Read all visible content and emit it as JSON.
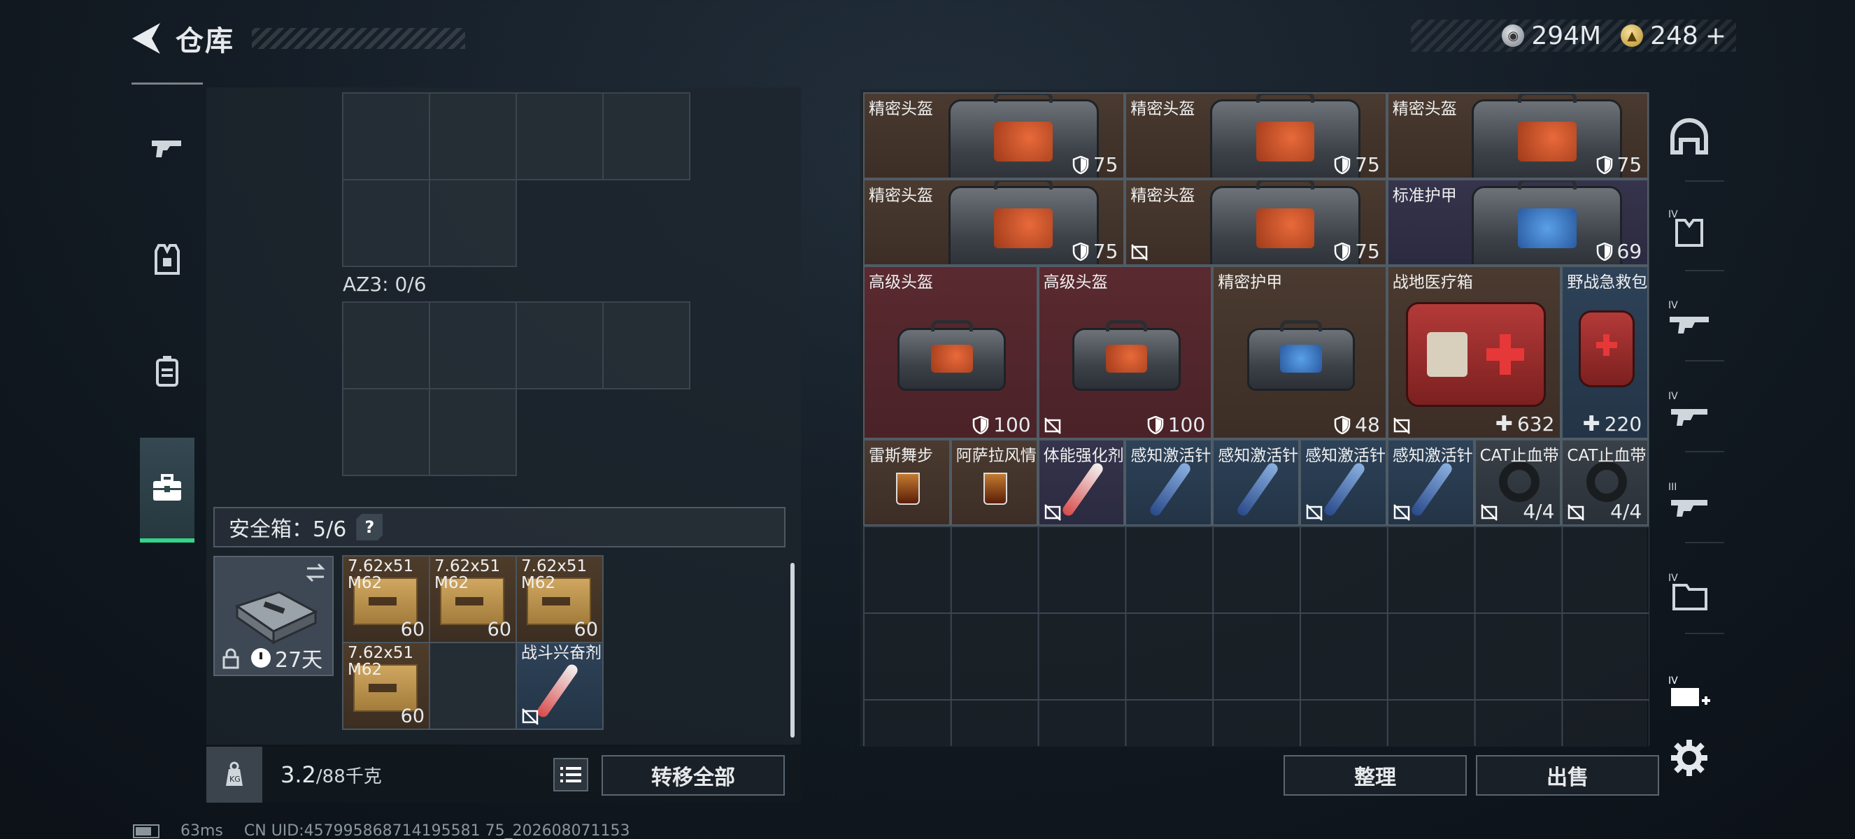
{
  "header": {
    "title": "仓库"
  },
  "currency": {
    "silver": "294M",
    "gold": "248",
    "plus": "+"
  },
  "left_nav": [
    {
      "icon": "gun-icon"
    },
    {
      "icon": "armor-vest-icon"
    },
    {
      "icon": "backpack-icon"
    },
    {
      "icon": "toolbox-icon",
      "active": true
    }
  ],
  "storage": {
    "az_label": "AZ3: 0/6"
  },
  "safe_box": {
    "title": "安全箱：5/6",
    "help": "?",
    "timer": "27天",
    "items": [
      {
        "name": "7.62x51\nM62",
        "count": "60",
        "type": "ammo"
      },
      {
        "name": "7.62x51\nM62",
        "count": "60",
        "type": "ammo"
      },
      {
        "name": "7.62x51\nM62",
        "count": "60",
        "type": "ammo"
      },
      {
        "name": "7.62x51\nM62",
        "count": "60",
        "type": "ammo"
      },
      {
        "name": "",
        "count": "",
        "type": "blank"
      },
      {
        "name": "战斗兴奋剂",
        "count": "",
        "type": "syringe"
      }
    ]
  },
  "footer_left": {
    "weight": "3.2",
    "capacity": "/88千克",
    "transfer_label": "转移全部"
  },
  "items": [
    {
      "name": "精密头盔",
      "value": "75",
      "kind": "helmet",
      "style": "brown"
    },
    {
      "name": "精密头盔",
      "value": "75",
      "kind": "helmet",
      "style": "brown"
    },
    {
      "name": "精密头盔",
      "value": "75",
      "kind": "helmet",
      "style": "brown"
    },
    {
      "name": "精密头盔",
      "value": "75",
      "kind": "helmet",
      "style": "brown"
    },
    {
      "name": "精密头盔",
      "value": "75",
      "kind": "helmet",
      "style": "brown",
      "nosell": true
    },
    {
      "name": "标准护甲",
      "value": "69",
      "kind": "armor",
      "style": "purple"
    },
    {
      "name": "高级头盔",
      "value": "100",
      "kind": "helmet",
      "style": "red"
    },
    {
      "name": "高级头盔",
      "value": "100",
      "kind": "helmet",
      "style": "red",
      "nosell": true
    },
    {
      "name": "精密护甲",
      "value": "48",
      "kind": "armor",
      "style": "brown"
    },
    {
      "name": "战地医疗箱",
      "value": "632",
      "kind": "medkit",
      "style": "brown",
      "nosell": true
    },
    {
      "name": "野战急救包",
      "value": "220",
      "kind": "firstaid",
      "style": "blue"
    },
    {
      "name": "雷斯舞步",
      "value": "",
      "kind": "drink",
      "style": "brown"
    },
    {
      "name": "阿萨拉风情",
      "value": "",
      "kind": "drink",
      "style": "brown"
    },
    {
      "name": "体能强化剂",
      "value": "",
      "kind": "syringe-red",
      "style": "purple",
      "nosell": true
    },
    {
      "name": "感知激活针",
      "value": "",
      "kind": "syringe-blue",
      "style": "blue"
    },
    {
      "name": "感知激活针",
      "value": "",
      "kind": "syringe-blue",
      "style": "blue"
    },
    {
      "name": "感知激活针",
      "value": "",
      "kind": "syringe-blue",
      "style": "blue",
      "nosell": true
    },
    {
      "name": "感知激活针",
      "value": "",
      "kind": "syringe-blue",
      "style": "blue",
      "nosell": true
    },
    {
      "name": "CAT止血带",
      "value": "4/4",
      "kind": "tourniquet",
      "style": "grey",
      "nosell": true
    },
    {
      "name": "CAT止血带",
      "value": "4/4",
      "kind": "tourniquet",
      "style": "grey",
      "nosell": true
    }
  ],
  "right_nav": [
    {
      "icon": "helmet-slot-icon"
    },
    {
      "icon": "armor-tier-iv-icon"
    },
    {
      "icon": "rifle-tier-iv-icon"
    },
    {
      "icon": "gun-tier-iv-icon"
    },
    {
      "icon": "gun-tier-iii-icon"
    },
    {
      "icon": "folder-tier-iv-icon"
    },
    {
      "icon": "add-tier-iv-icon"
    },
    {
      "icon": "settings-gear-icon"
    }
  ],
  "footer_right": {
    "sort_label": "整理",
    "sell_label": "出售"
  },
  "status": {
    "ping": "63ms",
    "uid": "CN UID:457995868714195581 75_202608071153"
  },
  "colors": {
    "accent_green": "#34d48a",
    "panel": "#1c2228"
  }
}
